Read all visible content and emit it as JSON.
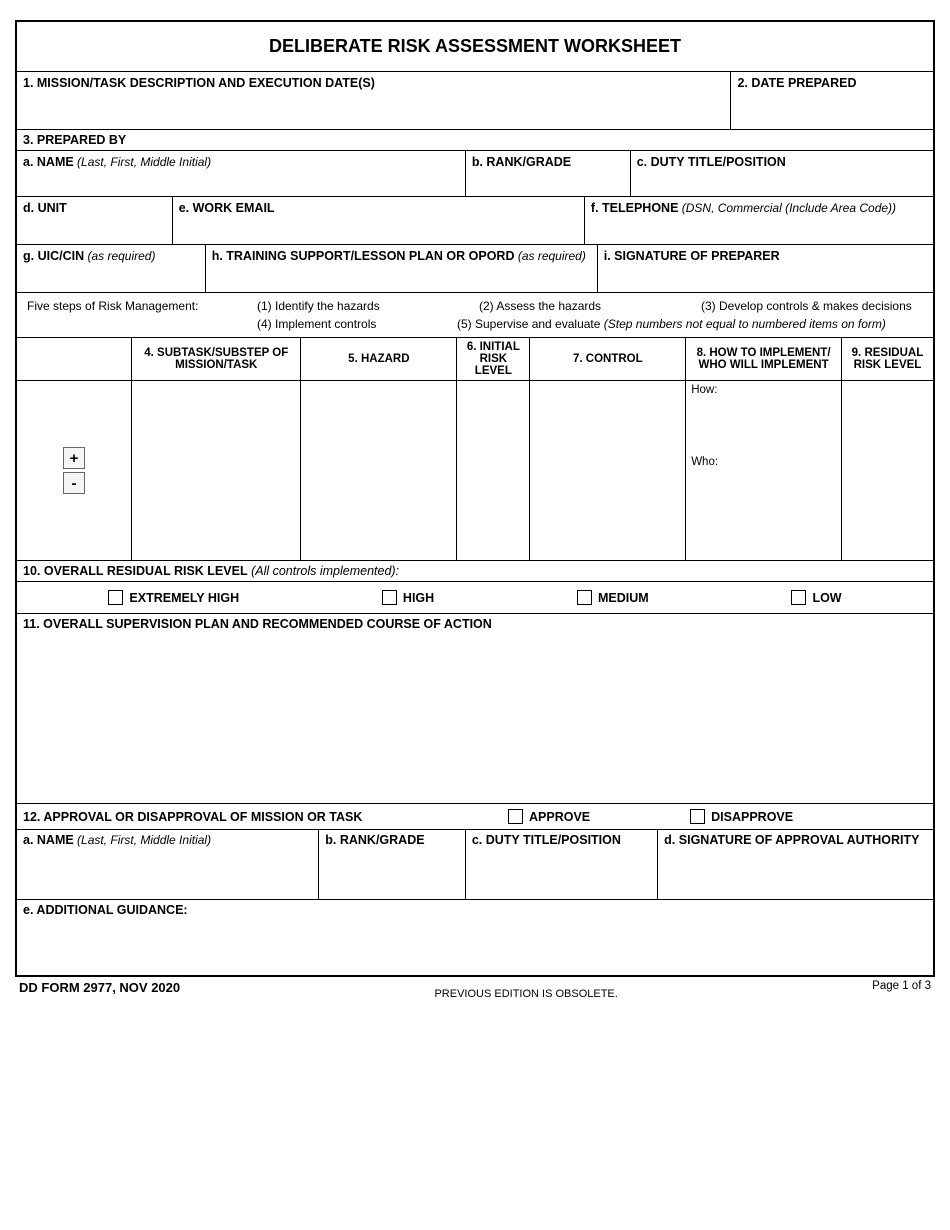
{
  "title": "DELIBERATE RISK ASSESSMENT WORKSHEET",
  "sec1": {
    "label": "1. MISSION/TASK DESCRIPTION AND EXECUTION DATE(S)"
  },
  "sec2": {
    "label": "2. DATE PREPARED"
  },
  "sec3": {
    "label": "3. PREPARED BY",
    "a": {
      "bold": "a. NAME",
      "italic": " (Last, First, Middle Initial)"
    },
    "b": {
      "bold": "b. RANK/GRADE"
    },
    "c": {
      "bold": "c. DUTY TITLE/POSITION"
    },
    "d": {
      "bold": "d. UNIT"
    },
    "e": {
      "bold": "e. WORK EMAIL"
    },
    "f": {
      "bold": "f. TELEPHONE",
      "italic": " (DSN, Commercial (Include Area Code))"
    },
    "g": {
      "bold": "g. UIC/CIN",
      "italic": " (as required)"
    },
    "h": {
      "bold": "h. TRAINING SUPPORT/LESSON PLAN OR OPORD",
      "italic": " (as required)"
    },
    "i": {
      "bold": "i. SIGNATURE OF PREPARER"
    }
  },
  "steps": {
    "intro": "Five steps of Risk Management:",
    "s1": "(1) Identify the hazards",
    "s2": "(2) Assess the hazards",
    "s3": "(3) Develop controls & makes decisions",
    "s4": "(4) Implement controls",
    "s5a": "(5) Supervise and evaluate ",
    "s5b": "(Step numbers not equal to numbered items on form)"
  },
  "grid": {
    "h0": "",
    "h4": "4. SUBTASK/SUBSTEP OF MISSION/TASK",
    "h5": "5. HAZARD",
    "h6": "6. INITIAL RISK LEVEL",
    "h7": "7. CONTROL",
    "h8": "8. HOW TO IMPLEMENT/ WHO WILL IMPLEMENT",
    "h9": "9. RESIDUAL RISK LEVEL",
    "how": "How:",
    "who": "Who:",
    "plus": "+",
    "minus": "-"
  },
  "sec10": {
    "bold": "10. OVERALL RESIDUAL RISK LEVEL",
    "italic": " (All controls implemented):",
    "opts": {
      "eh": "EXTREMELY HIGH",
      "h": "HIGH",
      "m": "MEDIUM",
      "l": "LOW"
    }
  },
  "sec11": {
    "label": "11. OVERALL SUPERVISION PLAN AND RECOMMENDED COURSE OF ACTION"
  },
  "sec12": {
    "label": "12. APPROVAL OR DISAPPROVAL OF MISSION OR TASK",
    "approve": "APPROVE",
    "disapprove": "DISAPPROVE",
    "a": {
      "bold": "a. NAME",
      "italic": " (Last, First, Middle Initial)"
    },
    "b": {
      "bold": "b. RANK/GRADE"
    },
    "c": {
      "bold": "c. DUTY TITLE/POSITION"
    },
    "d": {
      "bold": "d. SIGNATURE OF APPROVAL AUTHORITY"
    },
    "e": {
      "bold": "e. ADDITIONAL GUIDANCE:"
    }
  },
  "footer": {
    "left": "DD FORM 2977, NOV 2020",
    "center": "PREVIOUS EDITION IS OBSOLETE.",
    "right": "Page 1 of 3"
  }
}
